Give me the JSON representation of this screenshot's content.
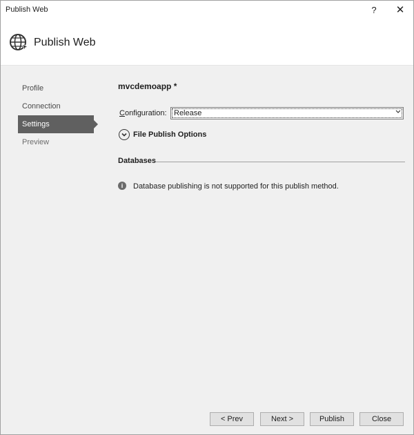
{
  "window": {
    "title": "Publish Web",
    "help_label": "?",
    "close_label": "✕"
  },
  "header": {
    "title": "Publish Web",
    "icon": "globe-icon"
  },
  "nav": {
    "items": [
      {
        "label": "Profile",
        "state": "normal"
      },
      {
        "label": "Connection",
        "state": "normal"
      },
      {
        "label": "Settings",
        "state": "selected"
      },
      {
        "label": "Preview",
        "state": "disabled"
      }
    ]
  },
  "settings": {
    "profile_name": "mvcdemoapp *",
    "configuration": {
      "label_first": "C",
      "label_rest": "onfiguration:",
      "value": "Release"
    },
    "file_publish_options_label": "File Publish Options",
    "databases_label": "Databases",
    "databases_message": "Database publishing is not supported for this publish method."
  },
  "footer": {
    "prev_label": "< Prev",
    "next_label": "Next >",
    "publish_label": "Publish",
    "close_label": "Close"
  },
  "colors": {
    "selected_nav": "#606060",
    "window_bg": "#f0f0f0"
  }
}
